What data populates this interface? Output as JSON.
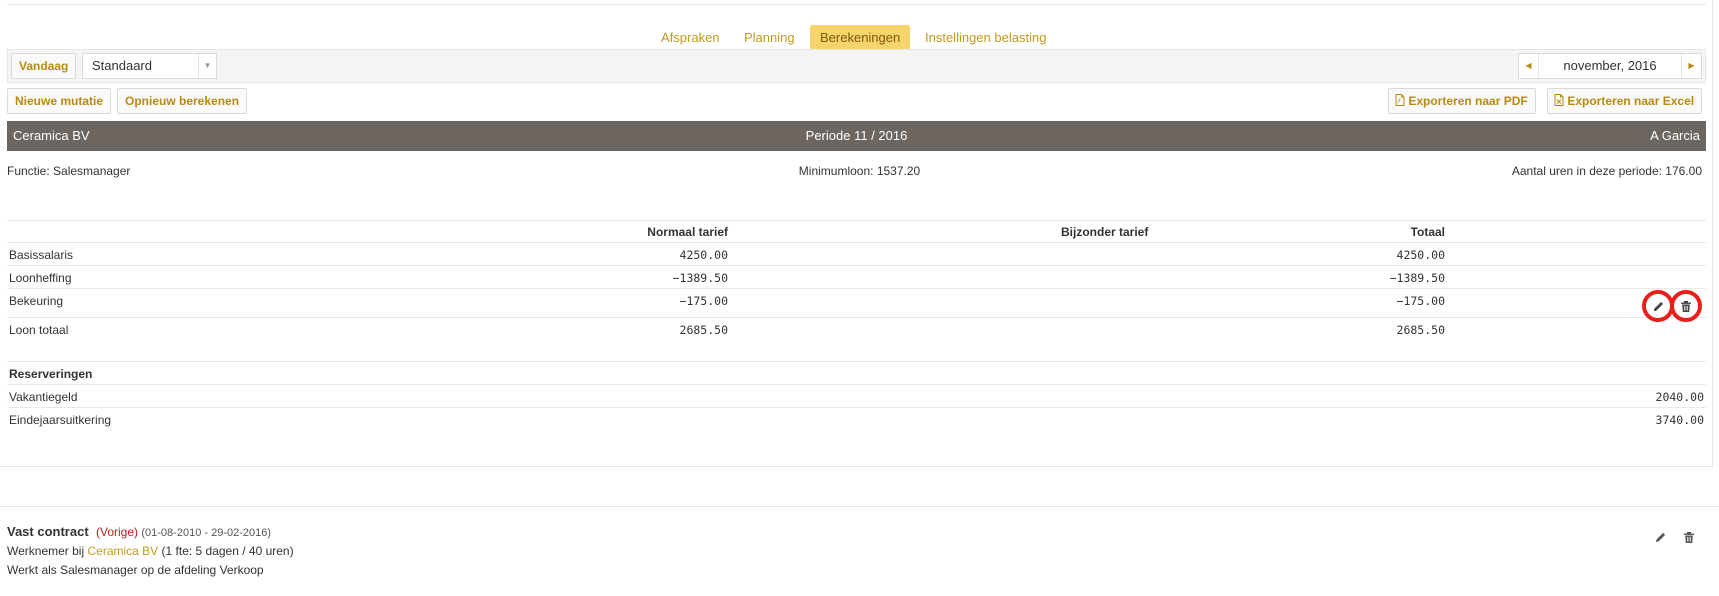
{
  "tabs": [
    {
      "label": "Afspraken"
    },
    {
      "label": "Planning"
    },
    {
      "label": "Berekeningen",
      "active": true
    },
    {
      "label": "Instellingen belasting"
    }
  ],
  "toolbar": {
    "today_label": "Vandaag",
    "view_select_value": "Standaard",
    "period_value": "november, 2016"
  },
  "actions": {
    "new_mutation": "Nieuwe mutatie",
    "recalculate": "Opnieuw berekenen",
    "export_pdf": "Exporteren naar PDF",
    "export_excel": "Exporteren naar Excel"
  },
  "header": {
    "company": "Ceramica BV",
    "period": "Periode 11 / 2016",
    "employee": "A Garcia"
  },
  "info": {
    "function": "Functie: Salesmanager",
    "minimum_wage": "Minimumloon: 1537.20",
    "hours": "Aantal uren in deze periode: 176.00"
  },
  "salary_table": {
    "columns": [
      "Normaal tarief",
      "Bijzonder tarief",
      "Totaal"
    ],
    "rows": [
      {
        "label": "Basissalaris",
        "normal": "4250.00",
        "special": "",
        "total": "4250.00"
      },
      {
        "label": "Loonheffing",
        "normal": "−1389.50",
        "special": "",
        "total": "−1389.50"
      },
      {
        "label": "Bekeuring",
        "normal": "−175.00",
        "special": "",
        "total": "−175.00",
        "editable": true
      },
      {
        "label": "Loon totaal",
        "normal": "2685.50",
        "special": "",
        "total": "2685.50"
      }
    ]
  },
  "reservations": {
    "title": "Reserveringen",
    "rows": [
      {
        "label": "Vakantiegeld",
        "value": "2040.00"
      },
      {
        "label": "Eindejaarsuitkering",
        "value": "3740.00"
      }
    ]
  },
  "contract": {
    "title": "Vast contract",
    "status": "(Vorige)",
    "dates": "(01-08-2010 - 29-02-2016)",
    "employee_prefix": "Werknemer bij",
    "company": "Ceramica BV",
    "fte": "(1 fte: 5 dagen / 40 uren)",
    "description": "Werkt als Salesmanager op de afdeling Verkoop"
  },
  "colors": {
    "accent": "#c29a1f",
    "active_tab": "#f6d36b",
    "header_bar": "#6d6660",
    "highlight_ring": "#e8201c",
    "status_previous": "#c41a1a"
  },
  "icons": [
    "pdf-file-icon",
    "excel-file-icon",
    "pencil-icon",
    "trash-icon",
    "chevron-left-icon",
    "chevron-right-icon",
    "caret-down-icon"
  ]
}
